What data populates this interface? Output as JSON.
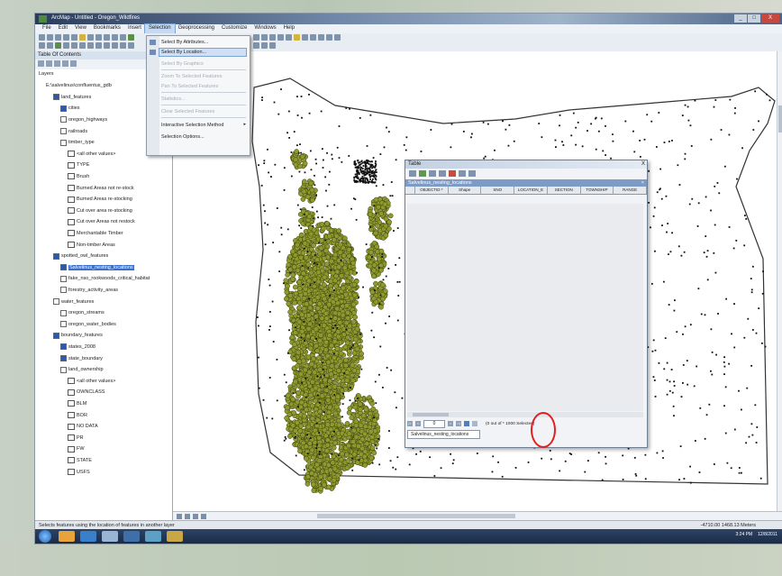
{
  "window": {
    "title": "ArcMap - Untitled - Oregon_Wildfires",
    "controls": [
      "_",
      "□",
      "X"
    ]
  },
  "menubar": {
    "items": [
      "File",
      "Edit",
      "View",
      "Bookmarks",
      "Insert",
      "Selection",
      "Geoprocessing",
      "Customize",
      "Windows",
      "Help"
    ],
    "active_index": 5
  },
  "selection_menu": {
    "items": [
      {
        "label": "Select By Attributes...",
        "disabled": false,
        "highlighted": false
      },
      {
        "label": "Select By Location...",
        "disabled": false,
        "highlighted": true
      },
      {
        "label": "Select By Graphics",
        "disabled": true,
        "highlighted": false
      },
      {
        "label": "Zoom To Selected Features",
        "disabled": true,
        "highlighted": false
      },
      {
        "label": "Pan To Selected Features",
        "disabled": true,
        "highlighted": false
      },
      {
        "label": "Statistics...",
        "disabled": true,
        "highlighted": false
      },
      {
        "label": "Clear Selected Features",
        "disabled": true,
        "highlighted": false
      },
      {
        "label": "Interactive Selection Method",
        "disabled": false,
        "highlighted": false,
        "submenu": true
      },
      {
        "label": "Selection Options...",
        "disabled": false,
        "highlighted": false
      }
    ]
  },
  "toc": {
    "header": "Table Of Contents",
    "items": [
      {
        "label": "Layers",
        "indent": 0,
        "checkbox": "none",
        "selected": false
      },
      {
        "label": "E:\\salvelinus\\confluentus_gdb",
        "indent": 1,
        "checkbox": "none",
        "selected": false
      },
      {
        "label": "land_features",
        "indent": 2,
        "checkbox": "on",
        "selected": false
      },
      {
        "label": "cities",
        "indent": 3,
        "checkbox": "on",
        "selected": false
      },
      {
        "label": "oregon_highways",
        "indent": 3,
        "checkbox": "off",
        "selected": false
      },
      {
        "label": "railroads",
        "indent": 3,
        "checkbox": "off",
        "selected": false
      },
      {
        "label": "timber_type",
        "indent": 3,
        "checkbox": "off",
        "selected": false
      },
      {
        "label": "<all other values>",
        "indent": 4,
        "checkbox": "none",
        "selected": false
      },
      {
        "label": "TYPE",
        "indent": 4,
        "checkbox": "none",
        "selected": false
      },
      {
        "label": "Brush",
        "indent": 4,
        "checkbox": "none",
        "selected": false
      },
      {
        "label": "Burned Areas not re-stock",
        "indent": 4,
        "checkbox": "none",
        "selected": false
      },
      {
        "label": "Burned Areas re-stocking",
        "indent": 4,
        "checkbox": "none",
        "selected": false
      },
      {
        "label": "Cut over area re-stocking",
        "indent": 4,
        "checkbox": "none",
        "selected": false
      },
      {
        "label": "Cut over Areas not restock",
        "indent": 4,
        "checkbox": "none",
        "selected": false
      },
      {
        "label": "Merchantable Timber",
        "indent": 4,
        "checkbox": "none",
        "selected": false
      },
      {
        "label": "Non-timber Areas",
        "indent": 4,
        "checkbox": "none",
        "selected": false
      },
      {
        "label": "spotted_owl_features",
        "indent": 2,
        "checkbox": "on",
        "selected": false
      },
      {
        "label": "Salvelinus_nesting_locations",
        "indent": 3,
        "checkbox": "on",
        "selected": true
      },
      {
        "label": "fake_nso_rookwoods_critical_habitat",
        "indent": 3,
        "checkbox": "off",
        "selected": false
      },
      {
        "label": "forestry_activity_areas",
        "indent": 3,
        "checkbox": "off",
        "selected": false
      },
      {
        "label": "water_features",
        "indent": 2,
        "checkbox": "off",
        "selected": false
      },
      {
        "label": "oregon_streams",
        "indent": 3,
        "checkbox": "off",
        "selected": false
      },
      {
        "label": "oregon_water_bodies",
        "indent": 3,
        "checkbox": "off",
        "selected": false
      },
      {
        "label": "boundary_features",
        "indent": 2,
        "checkbox": "on",
        "selected": false
      },
      {
        "label": "states_2008",
        "indent": 3,
        "checkbox": "on",
        "selected": false
      },
      {
        "label": "state_boundary",
        "indent": 3,
        "checkbox": "on",
        "selected": false
      },
      {
        "label": "land_ownership",
        "indent": 3,
        "checkbox": "off",
        "selected": false
      },
      {
        "label": "<all other values>",
        "indent": 4,
        "checkbox": "none",
        "selected": false
      },
      {
        "label": "OWNCLASS",
        "indent": 4,
        "checkbox": "none",
        "selected": false
      },
      {
        "label": "BLM",
        "indent": 4,
        "checkbox": "none",
        "selected": false
      },
      {
        "label": "BOR",
        "indent": 4,
        "checkbox": "none",
        "selected": false
      },
      {
        "label": "NO DATA",
        "indent": 4,
        "checkbox": "none",
        "selected": false
      },
      {
        "label": "PR",
        "indent": 4,
        "checkbox": "none",
        "selected": false
      },
      {
        "label": "FW",
        "indent": 4,
        "checkbox": "none",
        "selected": false
      },
      {
        "label": "STATE",
        "indent": 4,
        "checkbox": "none",
        "selected": false
      },
      {
        "label": "USFS",
        "indent": 4,
        "checkbox": "none",
        "selected": false
      }
    ]
  },
  "table_window": {
    "title": "Table",
    "close": "X",
    "table_name": "Salvelinus_nesting_locations",
    "columns": [
      "OBJECTID *",
      "Shape",
      "SNO",
      "LOCATION_E",
      "SECTION",
      "TOWNSHIP",
      "RANGE"
    ],
    "record_box": "0",
    "nav_buttons": [
      "|<",
      "<",
      ">",
      ">|"
    ],
    "count_text": "(0 out of * 1000 Selected)",
    "tab_label": "Salvelinus_nesting_locations"
  },
  "status": {
    "left": "Selects features using the location of features in another layer",
    "right": "-4710.00  1468.13 Meters"
  },
  "taskbar": {
    "tray_time": "3:24 PM",
    "tray_date": "12/8/2011"
  },
  "colors": {
    "selected_layer_fill": "#8f9a2e",
    "points": "#111111",
    "highlight_circle": "#e02020",
    "menu_highlight": "#cfe0f6"
  },
  "icons": [
    "app-icon",
    "windows-start-icon",
    "taskbar-app-icons",
    "toolbar-icons"
  ]
}
